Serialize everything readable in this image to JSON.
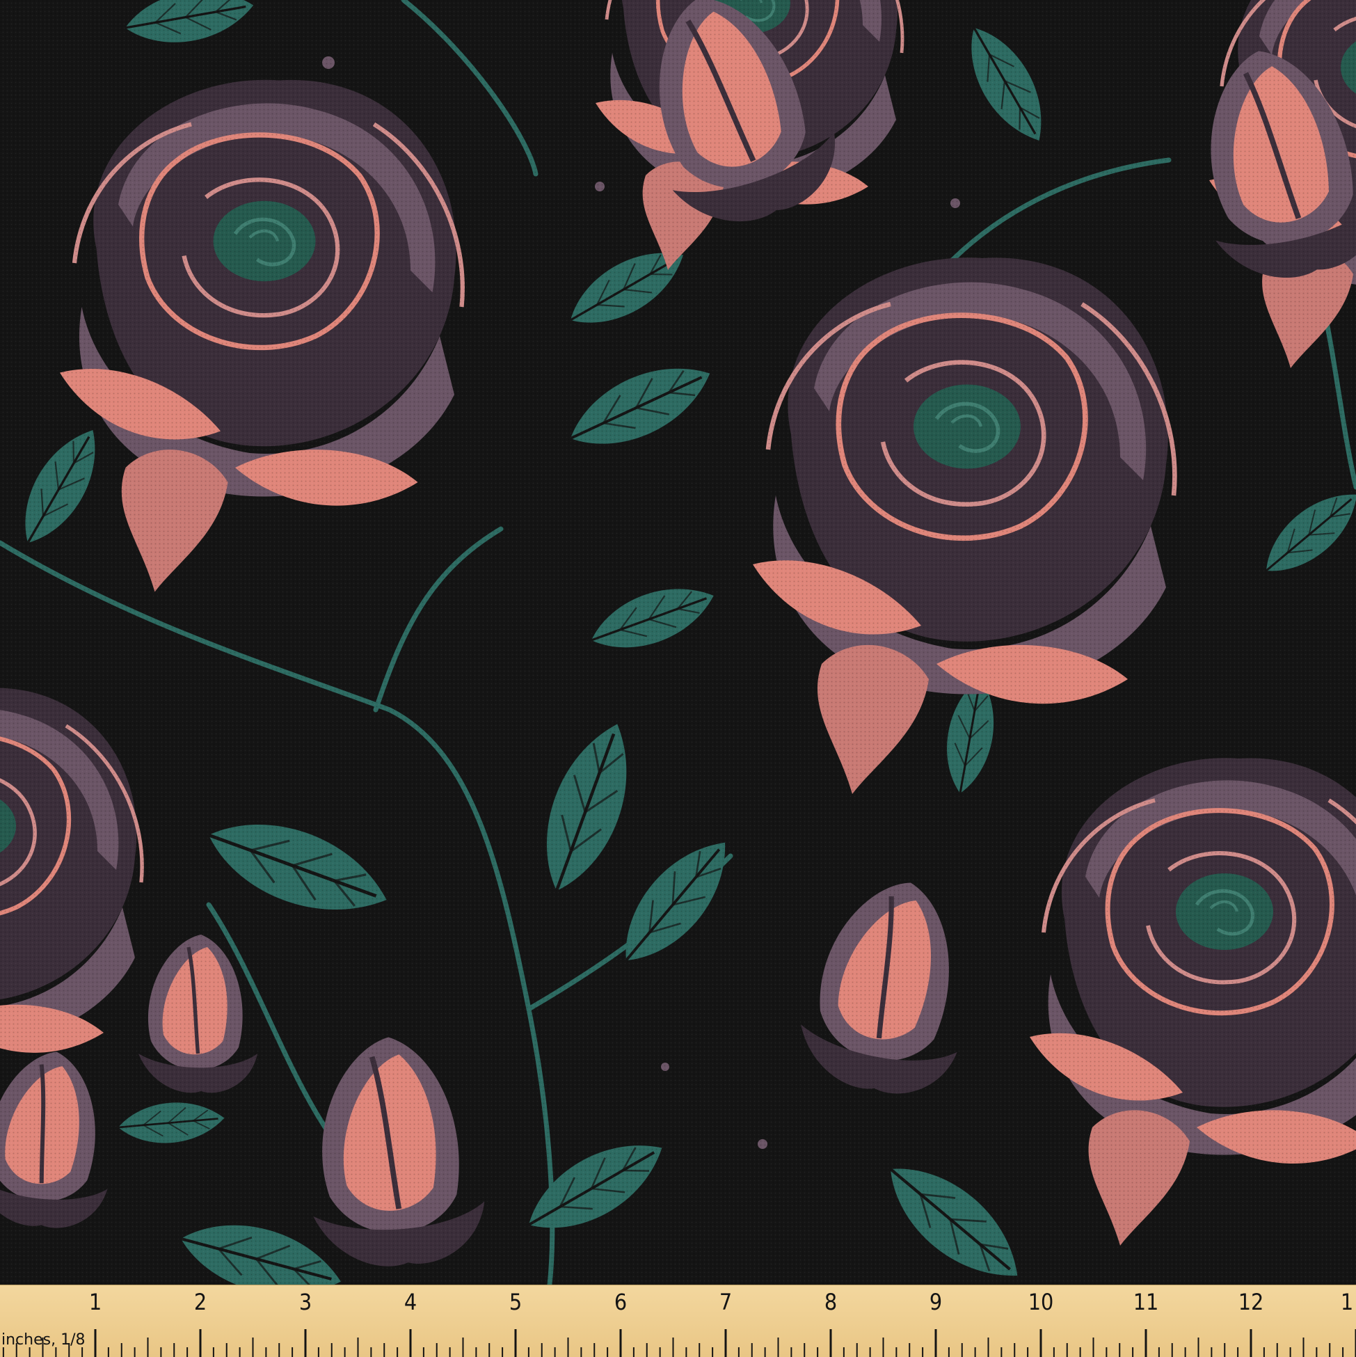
{
  "image": {
    "subject": "fabric-swatch",
    "pattern": "roses",
    "palette": {
      "background": "#141414",
      "petal_pink": "#e0867a",
      "petal_mauve": "#6b5566",
      "petal_dark": "#3b2e3a",
      "leaf": "#2d6b62",
      "rose_center": "#255a4e",
      "ruler": "#f0d293"
    }
  },
  "ruler": {
    "unit_label": "inches, 1/8",
    "numbers": [
      "1",
      "2",
      "3",
      "4",
      "5",
      "6",
      "7",
      "8",
      "9",
      "10",
      "11",
      "12",
      "1"
    ]
  }
}
